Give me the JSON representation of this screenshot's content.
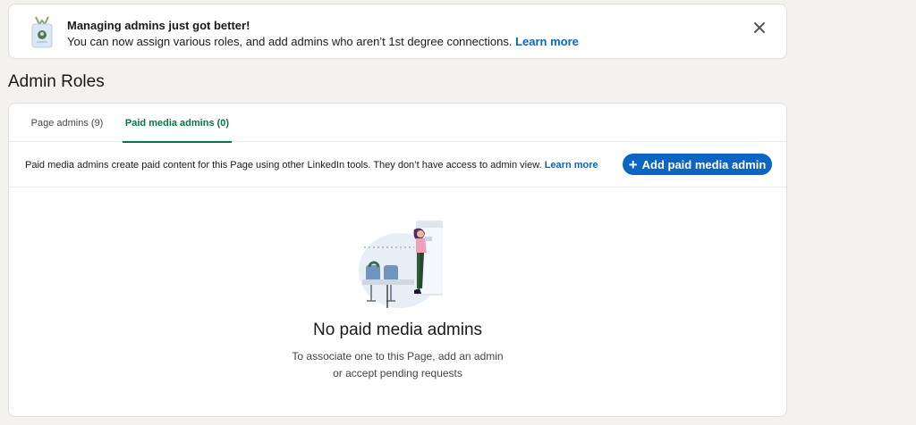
{
  "banner": {
    "title": "Managing admins just got better!",
    "text": "You can now assign various roles, and add admins who aren’t 1st degree connections.",
    "link": "Learn more",
    "icon": "admin-badge-icon",
    "close_icon": "close-icon"
  },
  "section": {
    "title": "Admin Roles"
  },
  "tabs": [
    {
      "label": "Page admins (9)",
      "selected": false
    },
    {
      "label": "Paid media admins (0)",
      "selected": true
    }
  ],
  "info": {
    "text": "Paid media admins create paid content for this Page using other LinkedIn tools. They don’t have access to admin view.",
    "link": "Learn more"
  },
  "add_button": {
    "label": "Add paid media admin",
    "icon": "plus-icon"
  },
  "empty_state": {
    "title": "No paid media admins",
    "line1": "To associate one to this Page, add an admin",
    "line2": "or accept pending requests",
    "illustration": "waiting-room-illustration"
  },
  "colors": {
    "accent": "#0a66c2",
    "selected_tab": "#057642",
    "background": "#f3f2ef"
  }
}
